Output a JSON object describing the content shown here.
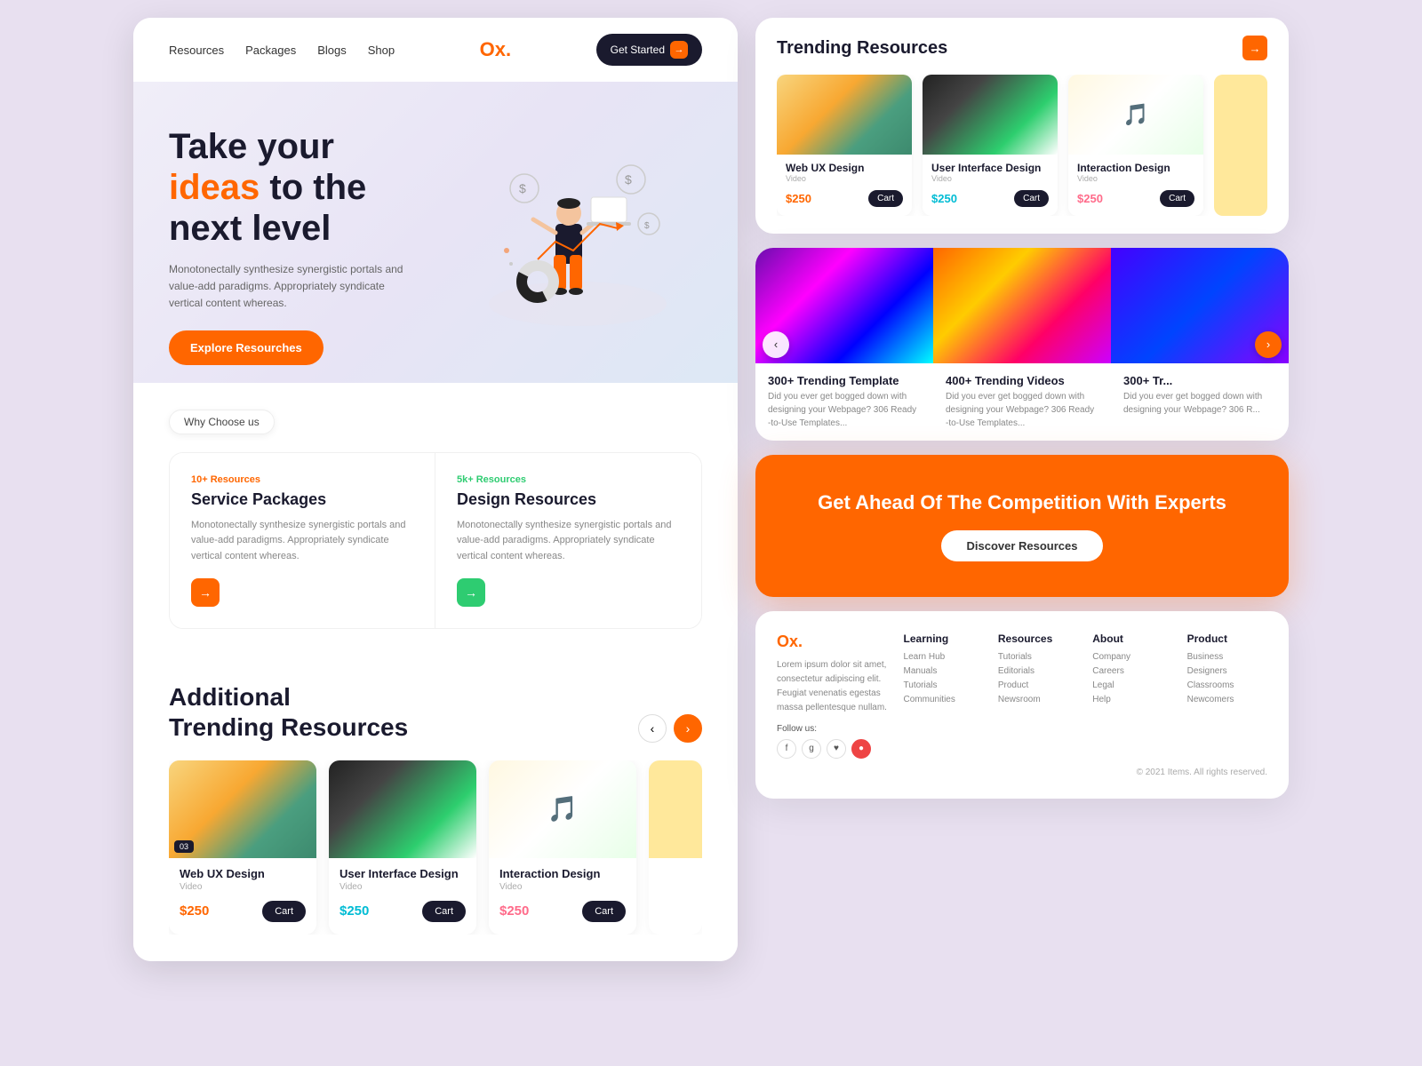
{
  "nav": {
    "links": [
      "Resources",
      "Packages",
      "Blogs",
      "Shop"
    ],
    "logo": "Ox.",
    "logo_accent": "O",
    "cta_label": "Get Started"
  },
  "hero": {
    "title_line1": "Take your",
    "title_highlight": "ideas",
    "title_line2": "to the",
    "title_line3": "next level",
    "subtitle": "Monotonectally synthesize synergistic portals and value-add paradigms. Appropriately syndicate vertical content whereas.",
    "cta_label": "Explore Resourches"
  },
  "why_choose": {
    "badge": "Why Choose us",
    "card1": {
      "tag": "10+ Resources",
      "title": "Service Packages",
      "desc": "Monotonectally synthesize synergistic portals and value-add paradigms. Appropriately syndicate vertical content whereas."
    },
    "card2": {
      "tag": "5k+ Resources",
      "title": "Design Resources",
      "desc": "Monotonectally synthesize synergistic portals and value-add paradigms. Appropriately syndicate vertical content whereas."
    }
  },
  "trending_left": {
    "title_line1": "Additional",
    "title_line2": "Trending Resources",
    "cards": [
      {
        "title": "Web UX Design",
        "type": "Video",
        "price": "$250",
        "price_class": "price-orange"
      },
      {
        "title": "User Interface Design",
        "type": "Video",
        "price": "$250",
        "price_class": "price-teal"
      },
      {
        "title": "Interaction Design",
        "type": "Video",
        "price": "$250",
        "price_class": "price-pink"
      }
    ],
    "cart_label": "Cart"
  },
  "top_trending": {
    "title": "Trending Resources",
    "cards": [
      {
        "title": "Web UX Design",
        "type": "Video",
        "price": "$250",
        "price_class": "top-price-orange"
      },
      {
        "title": "User Interface Design",
        "type": "Video",
        "price": "$250",
        "price_class": "top-price-teal"
      },
      {
        "title": "Interaction Design",
        "type": "Video",
        "price": "$250",
        "price_class": "top-price-pink"
      }
    ],
    "cart_label": "Cart"
  },
  "gallery": {
    "items": [
      {
        "title": "300+ Trending Template",
        "desc": "Did you ever get bogged down with designing your Webpage? 306 Ready -to-Use Templates..."
      },
      {
        "title": "400+ Trending Videos",
        "desc": "Did you ever get bogged down with designing your Webpage? 306 Ready -to-Use Templates..."
      },
      {
        "title": "300+ Tr...",
        "desc": "Did you ever get bogged down with designing your Webpage? 306 R..."
      }
    ]
  },
  "cta": {
    "title": "Get Ahead Of The Competition With Experts",
    "cta_label": "Discover Resources"
  },
  "footer": {
    "logo": "Ox.",
    "desc": "Lorem ipsum dolor sit amet, consectetur adipiscing elit. Feugiat venenatis egestas massa pellentesque nullam.",
    "follow_label": "Follow us:",
    "social_icons": [
      "f",
      "g+",
      "♥",
      "●"
    ],
    "columns": [
      {
        "heading": "Learning",
        "links": [
          "Learn Hub",
          "Manuals",
          "Tutorials",
          "Communities"
        ]
      },
      {
        "heading": "Resources",
        "links": [
          "Tutorials",
          "Editorials",
          "Product",
          "Newsroom"
        ]
      },
      {
        "heading": "About",
        "links": [
          "Company",
          "Careers",
          "Legal",
          "Help"
        ]
      },
      {
        "heading": "Product",
        "links": [
          "Business",
          "Designers",
          "Classrooms",
          "Newcomers"
        ]
      }
    ],
    "copyright": "© 2021 Items. All rights reserved."
  }
}
